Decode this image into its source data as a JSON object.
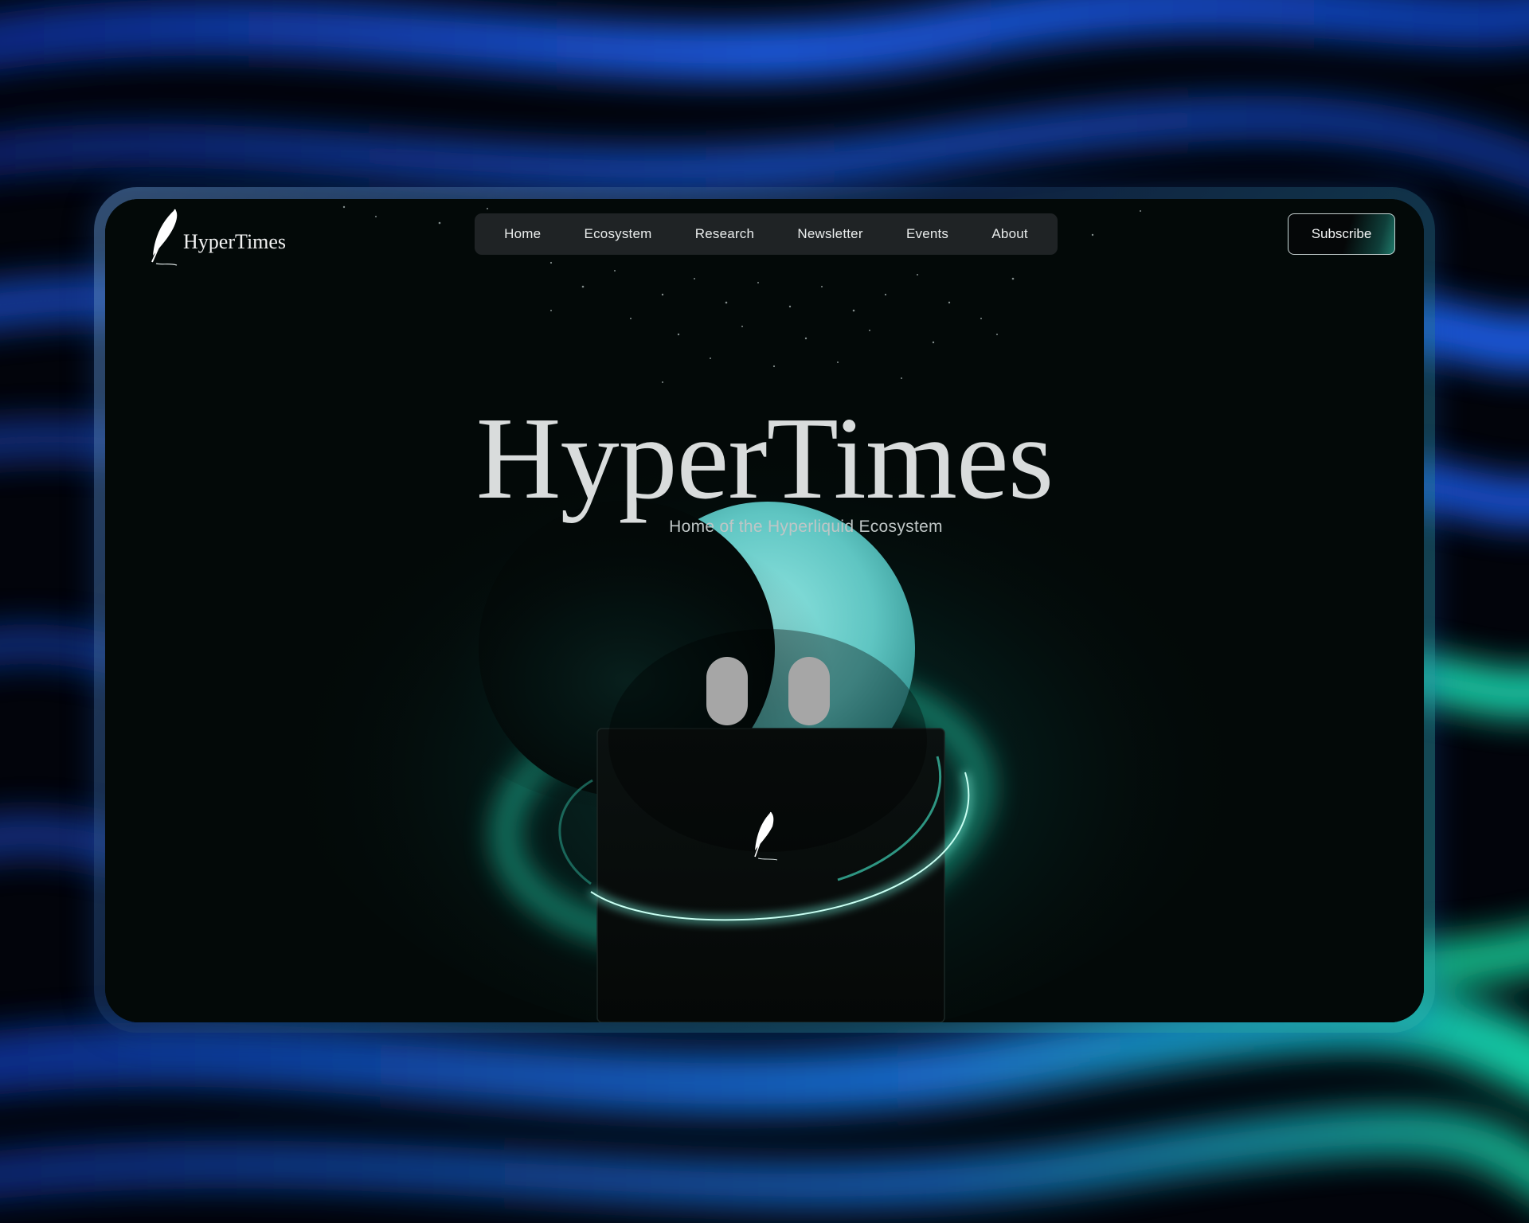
{
  "brand": {
    "name": "HyperTimes"
  },
  "nav": {
    "items": [
      {
        "label": "Home"
      },
      {
        "label": "Ecosystem"
      },
      {
        "label": "Research"
      },
      {
        "label": "Newsletter"
      },
      {
        "label": "Events"
      },
      {
        "label": "About"
      }
    ]
  },
  "header": {
    "subscribe_label": "Subscribe"
  },
  "hero": {
    "title": "HyperTimes",
    "subtitle": "Home of the Hyperliquid Ecosystem"
  },
  "icons": {
    "logo": "quill-feather-icon",
    "mascot": "mascot-ghost-illustration"
  },
  "colors": {
    "accent_teal": "#6fd6d2",
    "glow_green": "#22d6a6",
    "background_blue": "#1a5fe0",
    "screen_bg": "#030908"
  }
}
